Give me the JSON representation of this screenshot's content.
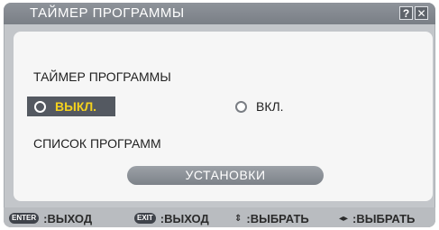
{
  "window": {
    "title": "ТАЙМЕР ПРОГРАММЫ",
    "help_icon": "?",
    "close_icon": "✕"
  },
  "panel": {
    "section_title": "ТАЙМЕР ПРОГРАММЫ",
    "options": {
      "off_label": "ВЫКЛ.",
      "on_label": "ВКЛ.",
      "selected": "ВЫКЛ."
    },
    "list_label": "СПИСОК ПРОГРАММ",
    "settings_button": "УСТАНОВКИ"
  },
  "footer": {
    "enter_key": "ENTER",
    "enter_action": ":ВЫХОД",
    "exit_key": "EXIT",
    "exit_action": ":ВЫХОД",
    "updown_glyph": "⇕",
    "updown_action": ":ВЫБРАТЬ",
    "leftright_glyph": "◂▸",
    "leftright_action": ":ВЫБРАТЬ"
  },
  "colors": {
    "selected_text": "#f5d21d",
    "titlebar": "#80858c",
    "panel": "#f6f6f6"
  }
}
